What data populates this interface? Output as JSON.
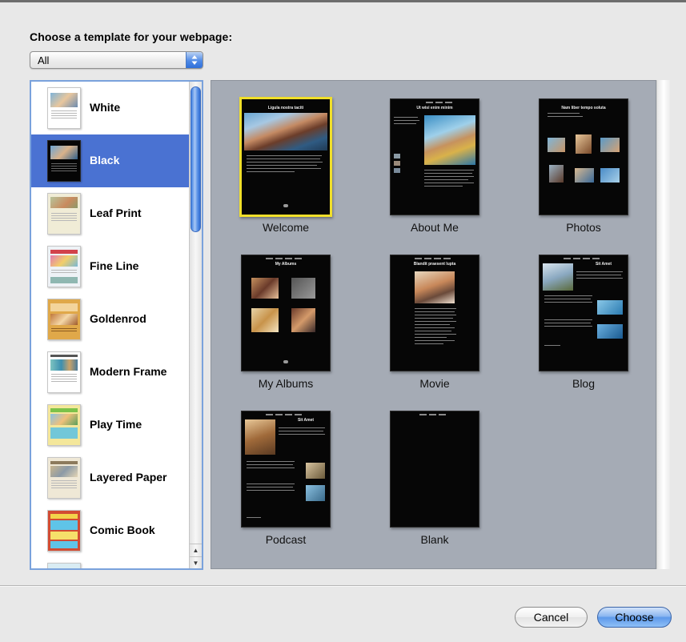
{
  "dialog": {
    "prompt": "Choose a template for your webpage:",
    "filter": {
      "selected": "All"
    }
  },
  "templates": [
    {
      "label": "White",
      "selected": false
    },
    {
      "label": "Black",
      "selected": true
    },
    {
      "label": "Leaf Print",
      "selected": false
    },
    {
      "label": "Fine Line",
      "selected": false
    },
    {
      "label": "Goldenrod",
      "selected": false
    },
    {
      "label": "Modern Frame",
      "selected": false
    },
    {
      "label": "Play Time",
      "selected": false
    },
    {
      "label": "Layered Paper",
      "selected": false
    },
    {
      "label": "Comic Book",
      "selected": false
    }
  ],
  "pages": [
    {
      "caption": "Welcome",
      "selected": true,
      "heading": "Ligula nostra taciti"
    },
    {
      "caption": "About Me",
      "selected": false,
      "heading": "Ut wisi enim minim"
    },
    {
      "caption": "Photos",
      "selected": false,
      "heading": "Nam liber tempo soluta"
    },
    {
      "caption": "My Albums",
      "selected": false,
      "heading": "My Albums"
    },
    {
      "caption": "Movie",
      "selected": false,
      "heading": "Blandit praesent lupta"
    },
    {
      "caption": "Blog",
      "selected": false,
      "heading": "Sit Amet"
    },
    {
      "caption": "Podcast",
      "selected": false,
      "heading": "Sit Amet"
    },
    {
      "caption": "Blank",
      "selected": false,
      "heading": ""
    }
  ],
  "buttons": {
    "cancel": "Cancel",
    "choose": "Choose"
  },
  "colors": {
    "selection": "#4a72d2",
    "gallery_background": "#a5abb5",
    "selected_page_border": "#f0df2a",
    "default_button": "#5d99ea"
  },
  "icons": {
    "popup_arrows": "up-down-arrows-icon",
    "scroll_up": "scroll-up-arrow-icon",
    "scroll_down": "scroll-down-arrow-icon"
  }
}
